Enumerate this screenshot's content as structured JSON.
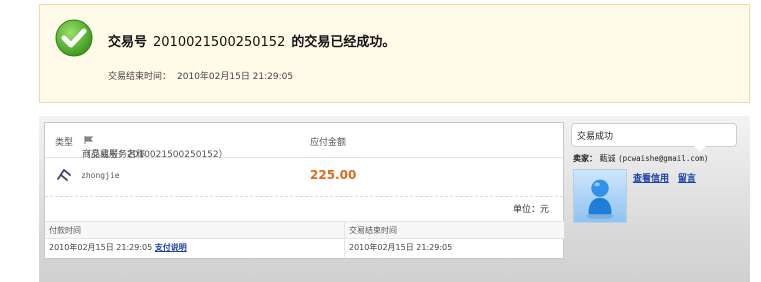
{
  "banner": {
    "title_prefix": "交易号",
    "trade_number": "2010021500250152",
    "title_suffix": "的交易已经成功。",
    "end_time_label": "交易结束时间：",
    "end_time_value": "2010年02月15日 21:29:05"
  },
  "table": {
    "col_type": "类型",
    "col_name": "商品或服务名称",
    "col_trade_number": "（交易号：2010021500250152）",
    "col_amount": "应付金额",
    "row": {
      "seller_name": "zhongjie",
      "amount": "225.00"
    },
    "unit": "单位：元",
    "pay_time_header": "付款时间",
    "end_time_header": "交易结束时间",
    "pay_time_value": "2010年02月15日 21:29:05",
    "pay_link": "支付说明",
    "end_time_value": "2010年02月15日 21:29:05"
  },
  "side": {
    "status": "交易成功",
    "seller_label": "卖家：",
    "seller_name": "甄诚",
    "seller_email": "(pcwaishe@gmail.com)",
    "view_credit": "查看信用",
    "message": "留言"
  },
  "colors": {
    "accent": "#e06a1a",
    "link": "#1a43a5",
    "banner_bg": "#fffbe8",
    "success": "#5db33a"
  }
}
